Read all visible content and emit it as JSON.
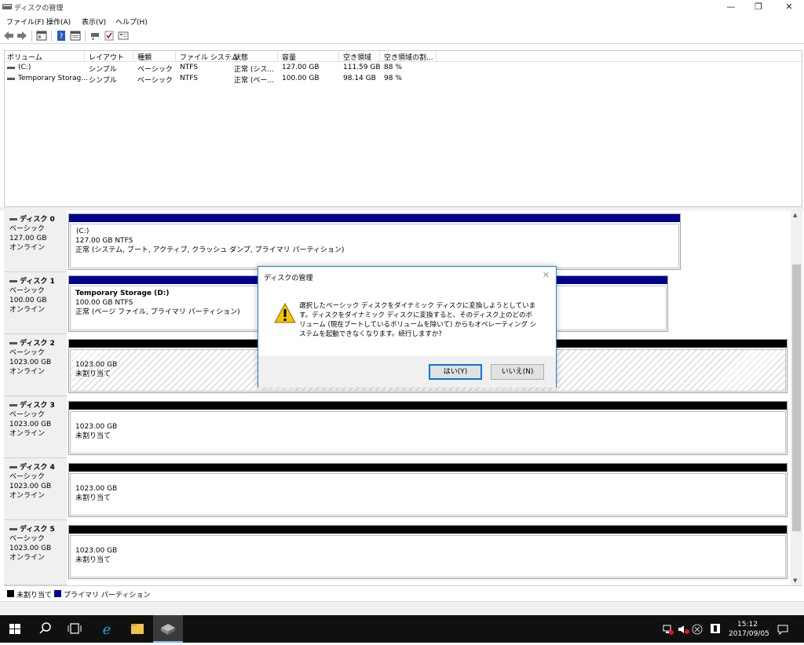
{
  "window": {
    "title": "ディスクの管理",
    "minimize": "—",
    "restore": "❐",
    "close": "✕"
  },
  "menu": [
    "ファイル(F)",
    "操作(A)",
    "表示(V)",
    "ヘルプ(H)"
  ],
  "toolbar_icons": [
    "back-icon",
    "forward-icon",
    "console-tree-icon",
    "help-icon",
    "properties-icon",
    "connect-icon",
    "check-icon",
    "settings-icon"
  ],
  "volume_list": {
    "columns": [
      "ボリューム",
      "レイアウト",
      "種類",
      "ファイル システム",
      "状態",
      "容量",
      "空き領域",
      "空き領域の割..."
    ],
    "rows": [
      [
        "(C:)",
        "シンプル",
        "ベーシック",
        "NTFS",
        "正常 (シス...",
        "127.00 GB",
        "111.59 GB",
        "88 %"
      ],
      [
        "Temporary Storag...",
        "シンプル",
        "ベーシック",
        "NTFS",
        "正常 (ペー...",
        "100.00 GB",
        "98.14 GB",
        "98 %"
      ]
    ]
  },
  "disks": [
    {
      "name": "ディスク 0",
      "type": "ベーシック",
      "size": "127.00 GB",
      "status": "オンライン",
      "partition": {
        "label": "(C:)",
        "size_fs": "127.00 GB NTFS",
        "desc": "正常 (システム, ブート, アクティブ, クラッシュ ダンプ, プライマリ パーティション)"
      }
    },
    {
      "name": "ディスク 1",
      "type": "ベーシック",
      "size": "100.00 GB",
      "status": "オンライン",
      "partition": {
        "label": "Temporary Storage  (D:)",
        "size_fs": "100.00 GB NTFS",
        "desc": "正常 (ページ ファイル, プライマリ パーティション)"
      }
    },
    {
      "name": "ディスク 2",
      "type": "ベーシック",
      "size": "1023.00 GB",
      "status": "オンライン",
      "partition": {
        "label": "1023.00 GB",
        "desc": "未割り当て"
      }
    },
    {
      "name": "ディスク 3",
      "type": "ベーシック",
      "size": "1023.00 GB",
      "status": "オンライン",
      "partition": {
        "label": "1023.00 GB",
        "desc": "未割り当て"
      }
    },
    {
      "name": "ディスク 4",
      "type": "ベーシック",
      "size": "1023.00 GB",
      "status": "オンライン",
      "partition": {
        "label": "1023.00 GB",
        "desc": "未割り当て"
      }
    },
    {
      "name": "ディスク 5",
      "type": "ベーシック",
      "size": "1023.00 GB",
      "status": "オンライン",
      "partition": {
        "label": "1023.00 GB",
        "desc": "未割り当て"
      }
    }
  ],
  "legend": [
    {
      "label": "未割り当て",
      "color": "#000000"
    },
    {
      "label": "プライマリ パーティション",
      "color": "#00008b"
    }
  ],
  "dialog": {
    "title": "ディスクの管理",
    "close": "✕",
    "message": "選択したベーシック ディスクをダイナミック ディスクに変換しようとしています。ディスクをダイナミック ディスクに変換すると、そのディスク上のどのボリューム (現在ブートしているボリュームを除いて) からもオペレーティング システムを起動できなくなります。続行しますか?",
    "yes": "はい(Y)",
    "no": "いいえ(N)"
  },
  "taskbar": {
    "time": "15:12",
    "date": "2017/09/05"
  },
  "colors": {
    "primary_partition": "#00008b",
    "unallocated": "#000000",
    "accent": "#0078d7"
  }
}
